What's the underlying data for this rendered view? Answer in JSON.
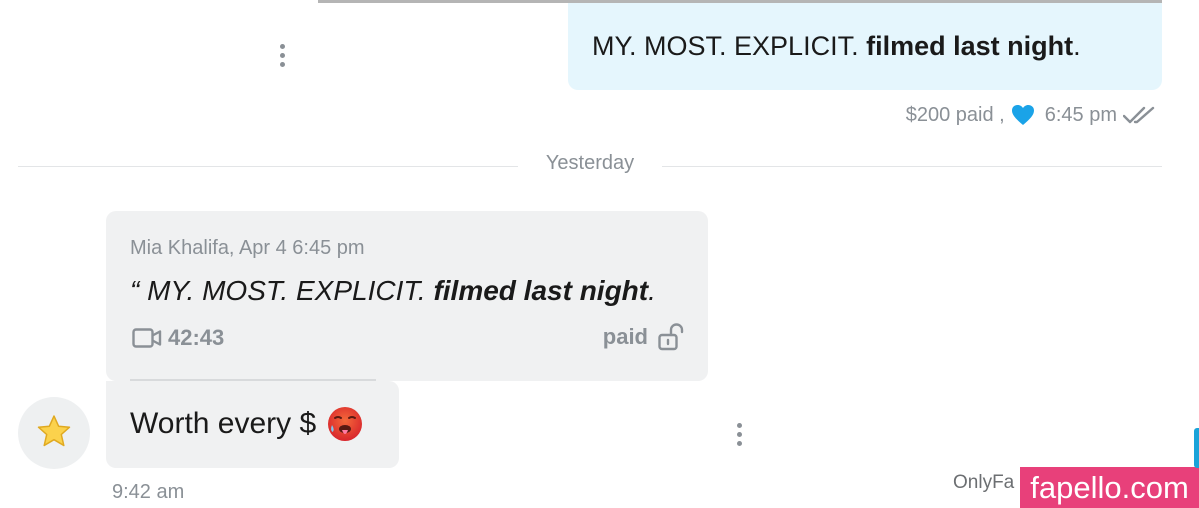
{
  "sent_message": {
    "text_regular": "MY. MOST. EXPLICIT. ",
    "text_bold": "filmed last night",
    "text_end": ".",
    "price_label": "$200 paid ,",
    "time": "6:45 pm",
    "heart_color": "#1aa3e8"
  },
  "date_divider": "Yesterday",
  "quoted_message": {
    "author_date": "Mia Khalifa, Apr 4 6:45 pm",
    "text_prefix": "“ MY. MOST. EXPLICIT. ",
    "text_bold": "filmed last night",
    "text_end": ".",
    "duration": "42:43",
    "paid_label": "paid"
  },
  "reply_message": {
    "text": "Worth every $",
    "time": "9:42 am"
  },
  "icons": {
    "more": "more-vertical-icon",
    "heart": "heart-icon",
    "read": "double-check-icon",
    "video": "video-camera-icon",
    "unlock": "unlock-icon",
    "emoji": "hot-face-emoji",
    "avatar": "star-icon"
  },
  "watermark": {
    "partial_text": "OnlyFa",
    "brand": "fapello.com",
    "brand_color": "#e8407a"
  },
  "colors": {
    "sent_bubble": "#e5f6fd",
    "received_bubble": "#f0f1f2",
    "muted_text": "#8a9096"
  }
}
